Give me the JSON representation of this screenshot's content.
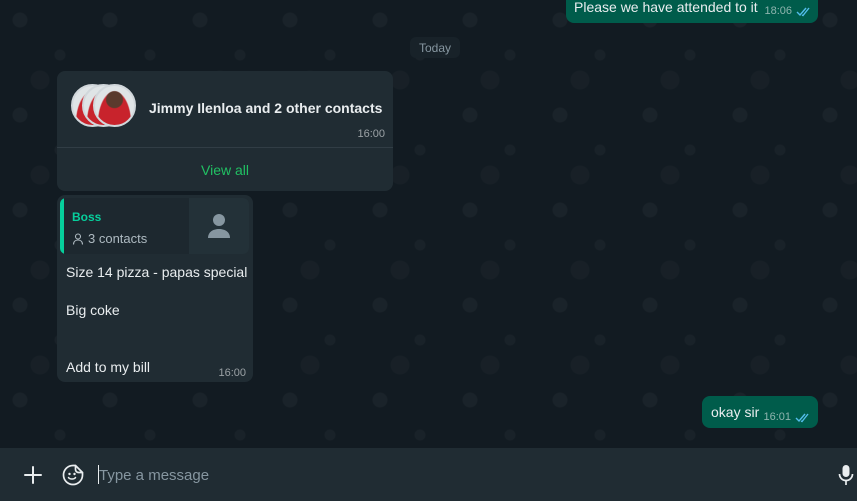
{
  "messages": {
    "top_outgoing": {
      "text": "Please we have attended to it",
      "time": "18:06"
    },
    "date_divider": "Today",
    "contacts_card": {
      "names": "Jimmy Ilenloa and 2 other contacts",
      "time": "16:00",
      "action": "View all"
    },
    "reply": {
      "quote_author": "Boss",
      "quote_subtitle": "3 contacts",
      "lines": [
        "Size 14 pizza - papas special",
        "Big coke",
        "Add to my bill"
      ],
      "time": "16:00"
    },
    "okay": {
      "text": "okay sir",
      "time": "16:01"
    }
  },
  "composer": {
    "placeholder": "Type a message"
  },
  "colors": {
    "outgoing": "#005c4b",
    "incoming": "#202c33",
    "accent": "#21c063",
    "quote_bar": "#06cf9c"
  },
  "icons": [
    "double-check-icon",
    "person-icon",
    "plus-icon",
    "sticker-icon",
    "microphone-icon"
  ]
}
